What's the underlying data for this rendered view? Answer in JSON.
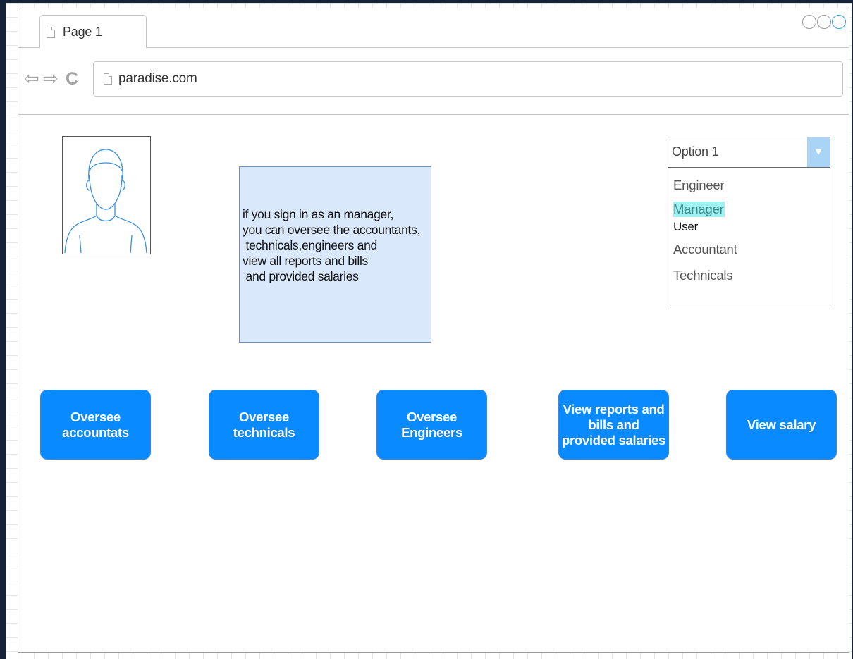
{
  "browser": {
    "tab_title": "Page 1",
    "url": "paradise.com",
    "nav": {
      "back_glyph": "⇦",
      "forward_glyph": "⇨",
      "reload_glyph": "C"
    }
  },
  "info_box": {
    "lines": [
      "if you sign in as an manager,",
      "you can oversee the accountants,",
      " technicals,engineers and",
      "view all reports and bills",
      " and provided salaries"
    ]
  },
  "role_select": {
    "value": "Option 1",
    "options": [
      "Engineer",
      "Manager",
      "User",
      "Accountant",
      "Technicals"
    ],
    "highlighted": "Manager"
  },
  "buttons": [
    {
      "label": "Oversee accountats"
    },
    {
      "label": "Oversee technicals"
    },
    {
      "label": "Oversee Engineers"
    },
    {
      "label": "View reports and bills and provided salaries"
    },
    {
      "label": "View salary"
    }
  ],
  "colors": {
    "button_fill": "#0a8aff",
    "info_fill": "#dae8fc",
    "highlight": "#9ff0f0"
  }
}
